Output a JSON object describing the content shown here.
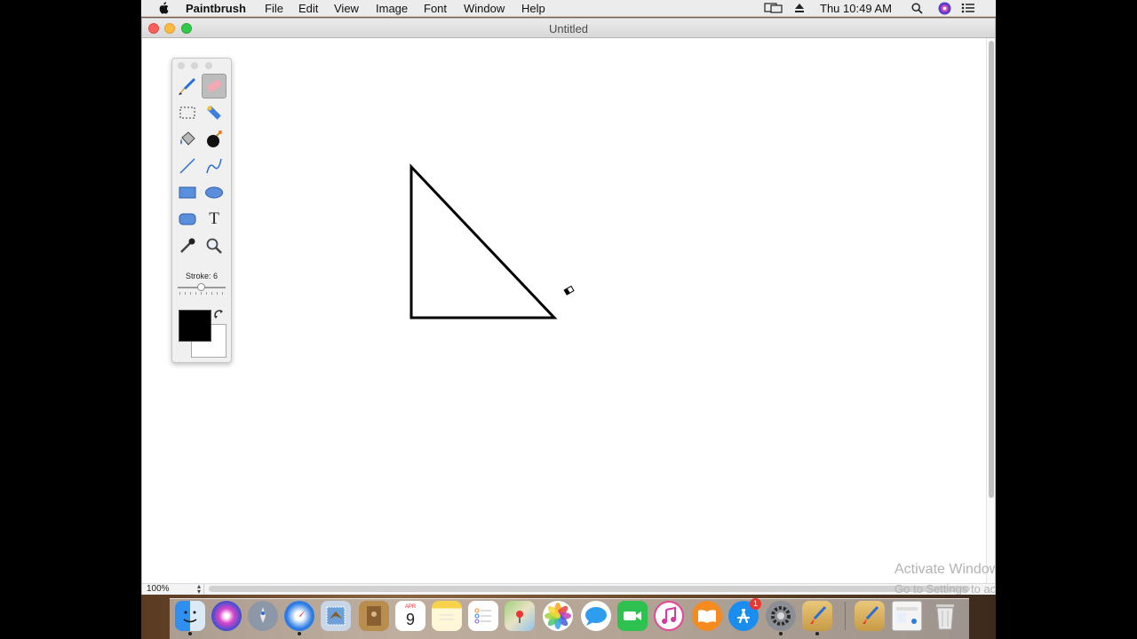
{
  "menubar": {
    "app_name": "Paintbrush",
    "items": [
      "File",
      "Edit",
      "View",
      "Image",
      "Font",
      "Window",
      "Help"
    ],
    "clock": "Thu 10:49 AM"
  },
  "window": {
    "title": "Untitled",
    "zoom_level": "100%"
  },
  "palette": {
    "tools": [
      "paintbrush-tool",
      "eraser-tool",
      "rectangle-select-tool",
      "magic-wand-tool",
      "fill-tool",
      "bomb-tool",
      "line-tool",
      "curve-tool",
      "rectangle-tool",
      "ellipse-tool",
      "rounded-rectangle-tool",
      "text-tool",
      "eyedropper-tool",
      "zoom-tool"
    ],
    "active_tool": "eraser-tool",
    "text_tool_glyph": "T",
    "stroke_label": "Stroke: 6",
    "foreground_color": "#000000",
    "background_color": "#ffffff"
  },
  "watermark": {
    "title": "Activate Windows",
    "subtitle": "Go to Settings to activate Windows."
  },
  "dock": {
    "calendar_month": "APR",
    "calendar_day": "9",
    "app_store_badge": "1",
    "apps": [
      "finder",
      "siri",
      "launchpad",
      "safari",
      "mail-eagle",
      "contacts",
      "calendar",
      "notes",
      "reminders",
      "maps",
      "photos",
      "messages",
      "facetime",
      "itunes",
      "ibooks",
      "app-store",
      "system-preferences",
      "paintbrush",
      "paintbrush-doc",
      "preview",
      "trash"
    ]
  }
}
